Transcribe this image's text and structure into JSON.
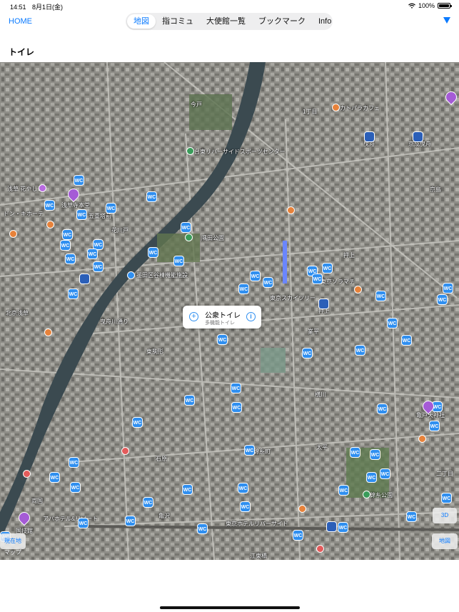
{
  "status_bar": {
    "time": "14:51",
    "date": "8月1日(金)",
    "battery": "100%"
  },
  "nav": {
    "home_label": "HOME",
    "tabs": [
      {
        "label": "地図",
        "active": true
      },
      {
        "label": "指コミュ",
        "active": false
      },
      {
        "label": "大使館一覧",
        "active": false
      },
      {
        "label": "ブックマーク",
        "active": false
      },
      {
        "label": "Info",
        "active": false
      }
    ],
    "filter_icon": "filter-triangle-icon"
  },
  "page_title": "トイレ",
  "map": {
    "labels": [
      "今戸",
      "台東リバーサイドスポーツセンター",
      "1丁目",
      "カトパラカフェ",
      "曳舟",
      "京成曳舟",
      "京島",
      "浅草 花やしき",
      "浅草寺本堂",
      "五重塔前",
      "ドン・キホーテ",
      "花川戸",
      "隅田公園",
      "押上",
      "東京ソラマチ",
      "墨田区谷棟機能施設",
      "東京スカイツリー",
      "押上",
      "業平",
      "東駒形",
      "横川",
      "亀戸天神社",
      "石原",
      "太平",
      "錦糸町",
      "錦糸公園",
      "両国",
      "亀沢",
      "江東橋",
      "東京ホテルリバーサイド",
      "アパホテル&リゾート",
      "国技館",
      "北京浅草",
      "二丁目",
      "曳舟川通り"
    ],
    "callout": {
      "title": "公衆トイレ",
      "subtitle": "多機能トイレ"
    },
    "wc_label": "WC",
    "btn_3d": "3D",
    "btn_current": "現在地",
    "btn_maptype": "地図",
    "watermark": "マップ"
  },
  "colors": {
    "accent": "#0a7aff",
    "wc": "#2f8ff0",
    "pin": "#a55bd6"
  }
}
